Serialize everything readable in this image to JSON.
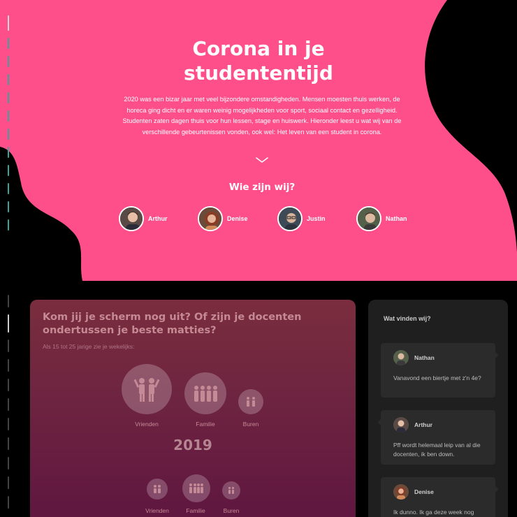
{
  "hero": {
    "title_line1": "Corona in je",
    "title_line2": "studententijd",
    "intro": "2020 was een bizar jaar met veel bijzondere omstandigheden. Mensen moesten thuis werken, de horeca ging dicht en er waren weinig mogelijkheden voor sport, sociaal contact en gezelligheid. Studenten zaten dagen thuis voor hun lessen, stage en huiswerk. Hieronder leest u wat wij van de verschillende gebeurtenissen vonden, ook wel: Het leven van een student in corona.",
    "scroll_icon": "chevron-down-icon",
    "who_title": "Wie zijn wij?",
    "people": [
      {
        "name": "Arthur"
      },
      {
        "name": "Denise"
      },
      {
        "name": "Justin"
      },
      {
        "name": "Nathan"
      }
    ]
  },
  "main": {
    "question": "Kom jij je scherm nog uit? Of zijn je docenten ondertussen je beste matties?",
    "subtitle": "Als 15 tot 25 jarige zie je wekelijks:",
    "groups_top": [
      {
        "label": "Vrienden",
        "icon": "friends-icon"
      },
      {
        "label": "Familie",
        "icon": "family-icon"
      },
      {
        "label": "Buren",
        "icon": "neighbours-icon"
      }
    ],
    "year": "2019",
    "groups_bottom": [
      {
        "label": "Vrienden",
        "icon": "friends-icon"
      },
      {
        "label": "Familie",
        "icon": "family-icon"
      },
      {
        "label": "Buren",
        "icon": "neighbours-icon"
      }
    ]
  },
  "sidebar": {
    "title": "Wat vinden wij?",
    "comments": [
      {
        "author": "Nathan",
        "text": "Vanavond een biertje met z'n 4e?"
      },
      {
        "author": "Arthur",
        "text": "Pff wordt helemaal leip van al die docenten, ik ben down."
      },
      {
        "author": "Denise",
        "text": "Ik dunno. Ik ga deze week nog"
      }
    ]
  },
  "colors": {
    "accent": "#ff4f8b",
    "background": "#000000",
    "card_top": "#7a2d3e",
    "card_bottom": "#5e1540",
    "sidebar_bg": "#1f1f1f",
    "timeline_teal": "#3aa39a"
  }
}
